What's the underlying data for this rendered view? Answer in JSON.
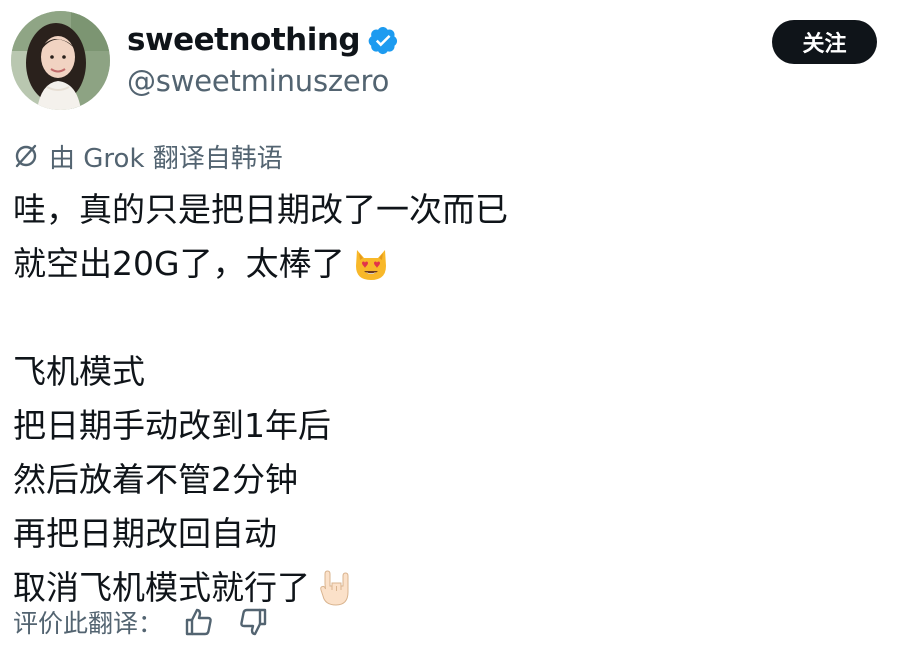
{
  "post": {
    "author": {
      "display_name": "sweetnothing",
      "handle": "@sweetminuszero",
      "verified": true,
      "avatar_icon": "avatar-photo"
    },
    "follow_label": "关注",
    "translation_note": "由 Grok 翻译自韩语",
    "translate_icon": "translate-icon",
    "body_lines": [
      "哇，真的只是把日期改了一次而已",
      "就空出20G了，太棒了",
      "",
      "飞机模式",
      "把日期手动改到1年后",
      "然后放着不管2分钟",
      "再把日期改回自动",
      "取消飞机模式就行了"
    ],
    "emojis": {
      "line2": "smiling-cat-heart-eyes-emoji",
      "line8": "sign-of-the-horns-emoji"
    },
    "rate_label": "评价此翻译：",
    "rate_icons": [
      "thumbs-up-icon",
      "thumbs-down-icon"
    ]
  },
  "colors": {
    "text_primary": "#0f1419",
    "text_secondary": "#536471",
    "follow_bg": "#0f1419",
    "verified": "#1d9bf0"
  }
}
